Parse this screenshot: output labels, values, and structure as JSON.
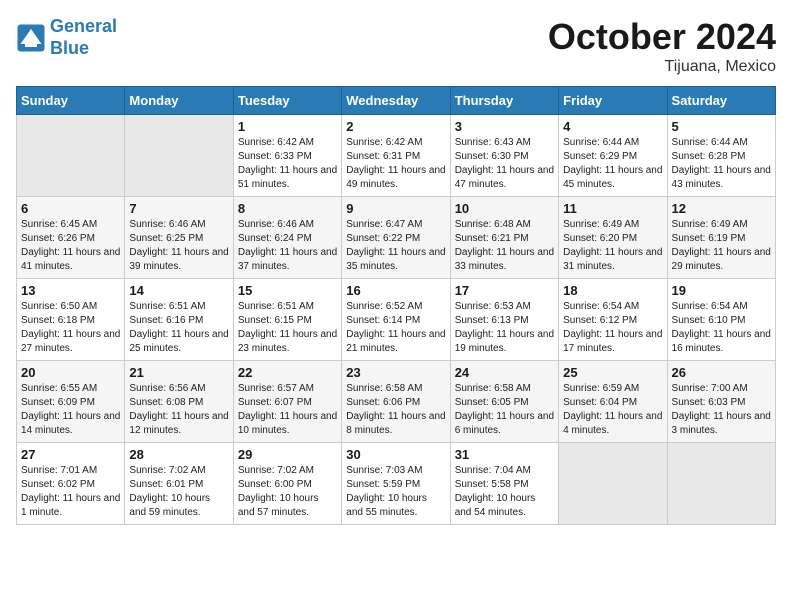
{
  "header": {
    "logo_line1": "General",
    "logo_line2": "Blue",
    "month": "October 2024",
    "location": "Tijuana, Mexico"
  },
  "weekdays": [
    "Sunday",
    "Monday",
    "Tuesday",
    "Wednesday",
    "Thursday",
    "Friday",
    "Saturday"
  ],
  "weeks": [
    [
      {
        "day": "",
        "info": ""
      },
      {
        "day": "",
        "info": ""
      },
      {
        "day": "1",
        "info": "Sunrise: 6:42 AM\nSunset: 6:33 PM\nDaylight: 11 hours and 51 minutes."
      },
      {
        "day": "2",
        "info": "Sunrise: 6:42 AM\nSunset: 6:31 PM\nDaylight: 11 hours and 49 minutes."
      },
      {
        "day": "3",
        "info": "Sunrise: 6:43 AM\nSunset: 6:30 PM\nDaylight: 11 hours and 47 minutes."
      },
      {
        "day": "4",
        "info": "Sunrise: 6:44 AM\nSunset: 6:29 PM\nDaylight: 11 hours and 45 minutes."
      },
      {
        "day": "5",
        "info": "Sunrise: 6:44 AM\nSunset: 6:28 PM\nDaylight: 11 hours and 43 minutes."
      }
    ],
    [
      {
        "day": "6",
        "info": "Sunrise: 6:45 AM\nSunset: 6:26 PM\nDaylight: 11 hours and 41 minutes."
      },
      {
        "day": "7",
        "info": "Sunrise: 6:46 AM\nSunset: 6:25 PM\nDaylight: 11 hours and 39 minutes."
      },
      {
        "day": "8",
        "info": "Sunrise: 6:46 AM\nSunset: 6:24 PM\nDaylight: 11 hours and 37 minutes."
      },
      {
        "day": "9",
        "info": "Sunrise: 6:47 AM\nSunset: 6:22 PM\nDaylight: 11 hours and 35 minutes."
      },
      {
        "day": "10",
        "info": "Sunrise: 6:48 AM\nSunset: 6:21 PM\nDaylight: 11 hours and 33 minutes."
      },
      {
        "day": "11",
        "info": "Sunrise: 6:49 AM\nSunset: 6:20 PM\nDaylight: 11 hours and 31 minutes."
      },
      {
        "day": "12",
        "info": "Sunrise: 6:49 AM\nSunset: 6:19 PM\nDaylight: 11 hours and 29 minutes."
      }
    ],
    [
      {
        "day": "13",
        "info": "Sunrise: 6:50 AM\nSunset: 6:18 PM\nDaylight: 11 hours and 27 minutes."
      },
      {
        "day": "14",
        "info": "Sunrise: 6:51 AM\nSunset: 6:16 PM\nDaylight: 11 hours and 25 minutes."
      },
      {
        "day": "15",
        "info": "Sunrise: 6:51 AM\nSunset: 6:15 PM\nDaylight: 11 hours and 23 minutes."
      },
      {
        "day": "16",
        "info": "Sunrise: 6:52 AM\nSunset: 6:14 PM\nDaylight: 11 hours and 21 minutes."
      },
      {
        "day": "17",
        "info": "Sunrise: 6:53 AM\nSunset: 6:13 PM\nDaylight: 11 hours and 19 minutes."
      },
      {
        "day": "18",
        "info": "Sunrise: 6:54 AM\nSunset: 6:12 PM\nDaylight: 11 hours and 17 minutes."
      },
      {
        "day": "19",
        "info": "Sunrise: 6:54 AM\nSunset: 6:10 PM\nDaylight: 11 hours and 16 minutes."
      }
    ],
    [
      {
        "day": "20",
        "info": "Sunrise: 6:55 AM\nSunset: 6:09 PM\nDaylight: 11 hours and 14 minutes."
      },
      {
        "day": "21",
        "info": "Sunrise: 6:56 AM\nSunset: 6:08 PM\nDaylight: 11 hours and 12 minutes."
      },
      {
        "day": "22",
        "info": "Sunrise: 6:57 AM\nSunset: 6:07 PM\nDaylight: 11 hours and 10 minutes."
      },
      {
        "day": "23",
        "info": "Sunrise: 6:58 AM\nSunset: 6:06 PM\nDaylight: 11 hours and 8 minutes."
      },
      {
        "day": "24",
        "info": "Sunrise: 6:58 AM\nSunset: 6:05 PM\nDaylight: 11 hours and 6 minutes."
      },
      {
        "day": "25",
        "info": "Sunrise: 6:59 AM\nSunset: 6:04 PM\nDaylight: 11 hours and 4 minutes."
      },
      {
        "day": "26",
        "info": "Sunrise: 7:00 AM\nSunset: 6:03 PM\nDaylight: 11 hours and 3 minutes."
      }
    ],
    [
      {
        "day": "27",
        "info": "Sunrise: 7:01 AM\nSunset: 6:02 PM\nDaylight: 11 hours and 1 minute."
      },
      {
        "day": "28",
        "info": "Sunrise: 7:02 AM\nSunset: 6:01 PM\nDaylight: 10 hours and 59 minutes."
      },
      {
        "day": "29",
        "info": "Sunrise: 7:02 AM\nSunset: 6:00 PM\nDaylight: 10 hours and 57 minutes."
      },
      {
        "day": "30",
        "info": "Sunrise: 7:03 AM\nSunset: 5:59 PM\nDaylight: 10 hours and 55 minutes."
      },
      {
        "day": "31",
        "info": "Sunrise: 7:04 AM\nSunset: 5:58 PM\nDaylight: 10 hours and 54 minutes."
      },
      {
        "day": "",
        "info": ""
      },
      {
        "day": "",
        "info": ""
      }
    ]
  ]
}
